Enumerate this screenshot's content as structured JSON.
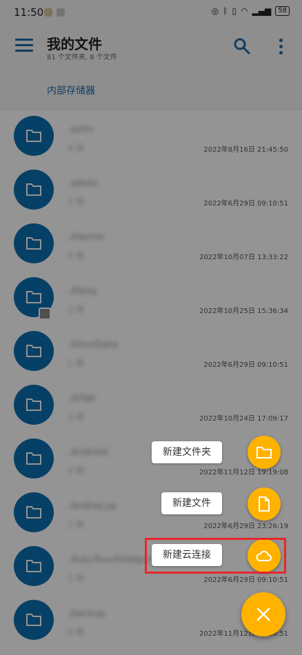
{
  "status_bar": {
    "time": "11:50",
    "battery": "58"
  },
  "app_bar": {
    "title": "我的文件",
    "subtitle": "81 个文件夹, 8 个文件"
  },
  "breadcrumb": "内部存储器",
  "files": [
    {
      "name": ".ashn",
      "count": "4 项",
      "date": "2022年8月16日 21:45:50"
    },
    {
      "name": ".adobi",
      "count": "2 项",
      "date": "2022年6月29日 09:10:51"
    },
    {
      "name": ".Alarms",
      "count": "0 项",
      "date": "2022年10月07日 13:33:22"
    },
    {
      "name": ".Alpay",
      "count": "2 项",
      "date": "2022年10月25日 15:36:34"
    },
    {
      "name": ".AlionData",
      "count": "1 项",
      "date": "2022年6月29日 09:10:51"
    },
    {
      "name": ".AlYak",
      "count": "3 项",
      "date": "2022年10月24日 17:09:17"
    },
    {
      "name": ".Android",
      "count": "4 项",
      "date": "2022年11月12日 19:19:08"
    },
    {
      "name": ".AndroLua",
      "count": "2 项",
      "date": "2022年6月29日 23:26:19"
    },
    {
      "name": ".AutoTouchHelper",
      "count": "1 项",
      "date": "2022年6月29日 09:10:51"
    },
    {
      "name": ".backup",
      "count": "0 项",
      "date": "2022年11月12日 09:10:51"
    }
  ],
  "speed_dial": {
    "new_folder": "新建文件夹",
    "new_file": "新建文件",
    "new_cloud": "新建云连接"
  },
  "colors": {
    "accent": "#ffb300",
    "primary": "#0d6fb0",
    "highlight": "#e8262c"
  }
}
